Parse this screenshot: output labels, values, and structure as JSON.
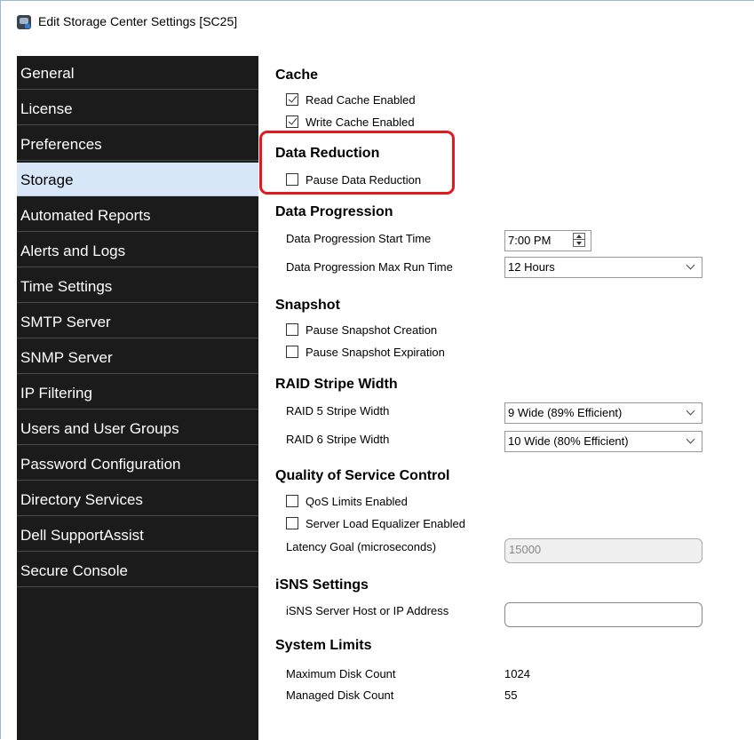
{
  "window": {
    "title": "Edit Storage Center Settings [SC25]"
  },
  "sidebar": {
    "items": [
      {
        "label": "General"
      },
      {
        "label": "License"
      },
      {
        "label": "Preferences"
      },
      {
        "label": "Storage"
      },
      {
        "label": "Automated Reports"
      },
      {
        "label": "Alerts and Logs"
      },
      {
        "label": "Time Settings"
      },
      {
        "label": "SMTP Server"
      },
      {
        "label": "SNMP Server"
      },
      {
        "label": "IP Filtering"
      },
      {
        "label": "Users and User Groups"
      },
      {
        "label": "Password Configuration"
      },
      {
        "label": "Directory Services"
      },
      {
        "label": "Dell SupportAssist"
      },
      {
        "label": "Secure Console"
      }
    ],
    "selected": "Storage"
  },
  "cache": {
    "title": "Cache",
    "read_cache": {
      "label": "Read Cache Enabled",
      "checked": true
    },
    "write_cache": {
      "label": "Write Cache Enabled",
      "checked": true
    }
  },
  "data_reduction": {
    "title": "Data Reduction",
    "pause": {
      "label": "Pause Data Reduction",
      "checked": false
    }
  },
  "data_progression": {
    "title": "Data Progression",
    "start_time_label": "Data Progression Start Time",
    "start_time_value": "7:00 PM",
    "max_run_label": "Data Progression Max Run Time",
    "max_run_value": "12 Hours"
  },
  "snapshot": {
    "title": "Snapshot",
    "pause_creation": {
      "label": "Pause Snapshot Creation",
      "checked": false
    },
    "pause_expiration": {
      "label": "Pause Snapshot Expiration",
      "checked": false
    }
  },
  "raid": {
    "title": "RAID Stripe Width",
    "raid5_label": "RAID 5 Stripe Width",
    "raid5_value": "9 Wide (89% Efficient)",
    "raid6_label": "RAID 6 Stripe Width",
    "raid6_value": "10 Wide (80% Efficient)"
  },
  "qos": {
    "title": "Quality of Service Control",
    "limits": {
      "label": "QoS Limits Enabled",
      "checked": false
    },
    "equalizer": {
      "label": "Server Load Equalizer Enabled",
      "checked": false
    },
    "latency_label": "Latency Goal (microseconds)",
    "latency_value": "15000"
  },
  "isns": {
    "title": "iSNS Settings",
    "host_label": "iSNS Server Host or IP Address",
    "host_value": ""
  },
  "system_limits": {
    "title": "System Limits",
    "max_disk_label": "Maximum Disk Count",
    "max_disk_value": "1024",
    "managed_disk_label": "Managed Disk Count",
    "managed_disk_value": "55"
  },
  "colors": {
    "sidebar_bg": "#1b1b1b",
    "selected_bg": "#d7e7f7",
    "highlight": "#e3191e"
  }
}
